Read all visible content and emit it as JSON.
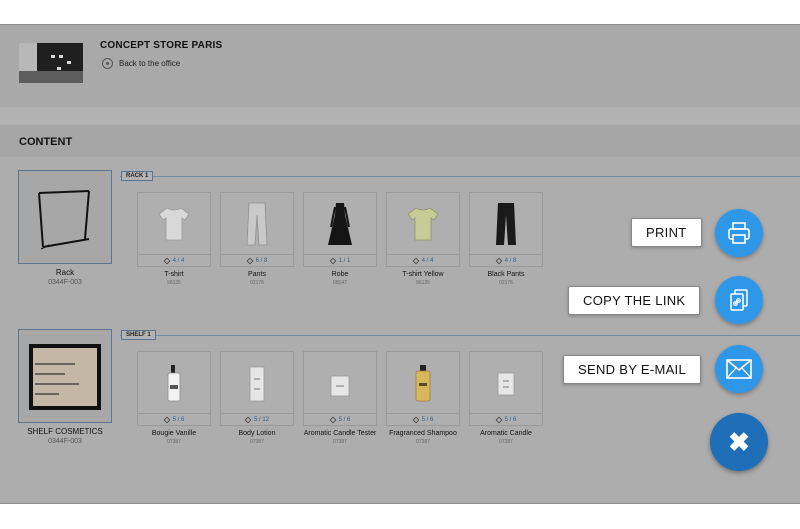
{
  "store": {
    "title": "CONCEPT STORE PARIS",
    "back_label": "Back to the office"
  },
  "content": {
    "title": "CONTENT"
  },
  "sections": [
    {
      "tag": "RACK 1",
      "container": {
        "name": "Rack",
        "code": "0344F-003",
        "icon": "rack-icon"
      },
      "products": [
        {
          "name": "T-shirt",
          "code": "96135",
          "count": "4 / 4",
          "icon": "tshirt-icon"
        },
        {
          "name": "Pants",
          "code": "02176",
          "count": "6 / 8",
          "icon": "pants-icon"
        },
        {
          "name": "Robe",
          "code": "08147",
          "count": "1 / 1",
          "icon": "dress-icon"
        },
        {
          "name": "T-shirt Yellow",
          "code": "96135",
          "count": "4 / 4",
          "icon": "tshirt-yellow-icon"
        },
        {
          "name": "Black Pants",
          "code": "02176",
          "count": "4 / 8",
          "icon": "black-pants-icon"
        }
      ]
    },
    {
      "tag": "SHELF 1",
      "container": {
        "name": "SHELF COSMETICS",
        "code": "0344F-003",
        "icon": "shelf-icon"
      },
      "products": [
        {
          "name": "Bougie Vanille",
          "code": "07387",
          "count": "5 / 6",
          "icon": "bottle-icon"
        },
        {
          "name": "Body Lotion",
          "code": "07387",
          "count": "5 / 12",
          "icon": "lotion-icon"
        },
        {
          "name": "Aromatic Candle Tester",
          "code": "07387",
          "count": "5 / 6",
          "icon": "candle-tester-icon"
        },
        {
          "name": "Fragranced Shampoo",
          "code": "07387",
          "count": "5 / 6",
          "icon": "shampoo-icon"
        },
        {
          "name": "Aromatic Candle",
          "code": "07387",
          "count": "5 / 6",
          "icon": "candle-icon"
        }
      ]
    }
  ],
  "actions": {
    "print_label": "PRINT",
    "copy_label": "COPY THE LINK",
    "email_label": "SEND BY E-MAIL",
    "close_symbol": "✖"
  },
  "colors": {
    "accent": "#2f97e8",
    "close": "#1e6fb8",
    "overlay": "#aeadad"
  }
}
